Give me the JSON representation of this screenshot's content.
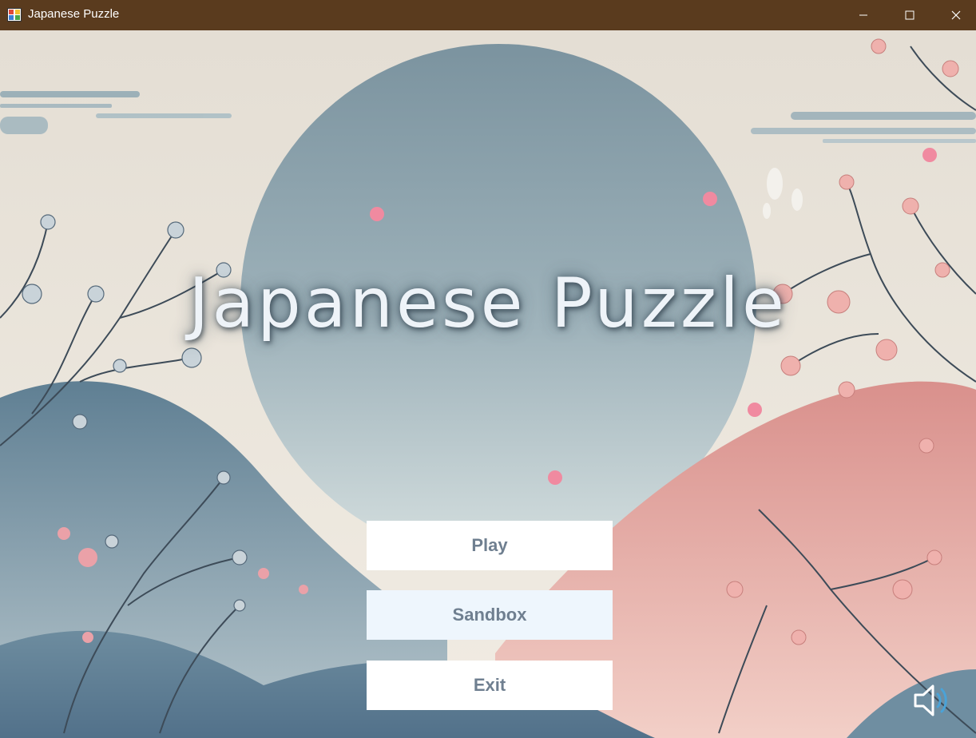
{
  "window": {
    "title": "Japanese Puzzle",
    "app_icon": "app-window-icon",
    "controls": {
      "minimize_icon": "minimize-icon",
      "maximize_icon": "maximize-icon",
      "close_icon": "close-icon"
    }
  },
  "main_menu": {
    "title": "Japanese Puzzle",
    "buttons": {
      "play": "Play",
      "sandbox": "Sandbox",
      "exit": "Exit"
    },
    "sound_icon": "speaker-volume-icon"
  },
  "colors": {
    "titlebar": "#5a3b1e",
    "moon": "#8fa5b0",
    "left_mountain": "#6f8fa3",
    "right_mountain": "#e0a8a3",
    "button_text": "#6f7f90",
    "sandbox_button_bg": "#eef6fd"
  }
}
